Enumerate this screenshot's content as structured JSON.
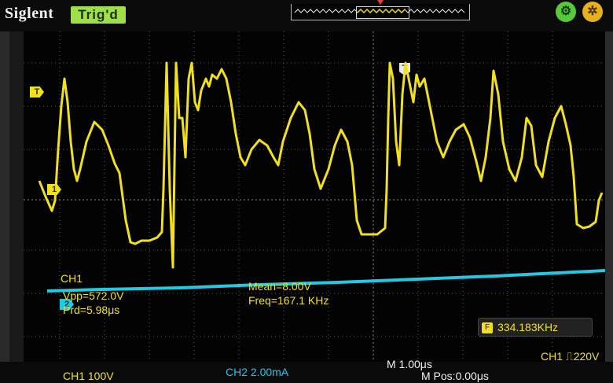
{
  "header": {
    "brand": "Siglent",
    "trigger_status": "Trig'd"
  },
  "status_icons": {
    "left_icon": "gear-icon",
    "right_icon": "cog-icon"
  },
  "markers": {
    "trigger_level": "T",
    "ch1": "1",
    "ch2": "2",
    "trigger_position": "T"
  },
  "measurements": {
    "channel": "CH1",
    "vpp": "Vpp=572.0V",
    "prd": "Prd=5.98μs",
    "mean": "Mean=8.00V",
    "freq": "Freq=167.1 KHz"
  },
  "counter": {
    "icon": "F",
    "value": "334.183KHz"
  },
  "footer": {
    "ch1": "CH1 100V",
    "ch2": "CH2 2.00mA",
    "timebase": "M 1.00μs",
    "mpos": "M Pos:0.00μs",
    "trigger": "CH1 ⎍220V"
  },
  "colors": {
    "ch1": "#f0e020",
    "ch2": "#25c8e0",
    "trigger_badge": "#9fe04a"
  }
}
